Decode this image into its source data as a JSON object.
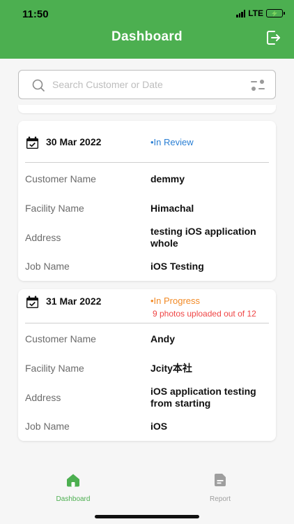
{
  "status_bar": {
    "time": "11:50",
    "network": "LTE"
  },
  "header": {
    "title": "Dashboard"
  },
  "search": {
    "placeholder": "Search Customer or Date"
  },
  "cards": [
    {
      "date": "30 Mar 2022",
      "status": "•In Review",
      "status_color": "#2a7fd4",
      "fields": [
        {
          "label": "Customer Name",
          "value": "demmy"
        },
        {
          "label": "Facility Name",
          "value": "Himachal"
        },
        {
          "label": "Address",
          "value": "testing iOS application whole"
        },
        {
          "label": "Job Name",
          "value": "iOS Testing"
        }
      ]
    },
    {
      "date": "31 Mar 2022",
      "status": "•In Progress",
      "status_color": "#f28a25",
      "upload_note": "9 photos uploaded out of 12",
      "fields": [
        {
          "label": "Customer Name",
          "value": "Andy"
        },
        {
          "label": "Facility Name",
          "value": "Jcity本社"
        },
        {
          "label": "Address",
          "value": "iOS application testing from starting"
        },
        {
          "label": "Job Name",
          "value": "iOS"
        }
      ]
    }
  ],
  "tabbar": {
    "items": [
      {
        "label": "Dashboard",
        "icon": "home-icon",
        "active": true
      },
      {
        "label": "Report",
        "icon": "report-icon",
        "active": false
      }
    ]
  },
  "colors": {
    "primary": "#4caf50",
    "review": "#2a7fd4",
    "progress": "#f28a25",
    "alert": "#ef4444"
  }
}
